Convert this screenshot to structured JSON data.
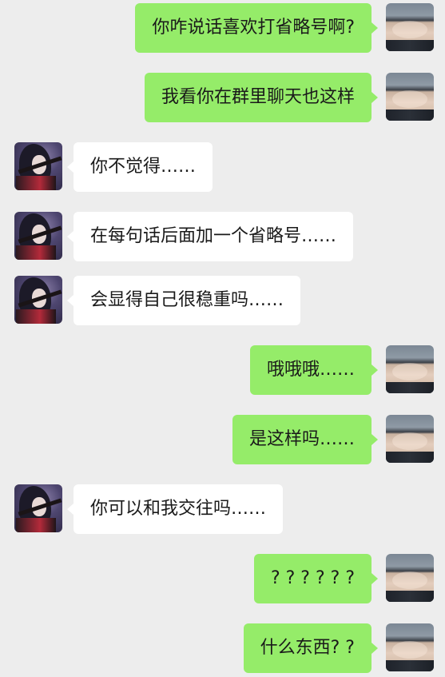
{
  "messages": [
    {
      "side": "right",
      "text": "你咋说话喜欢打省略号啊?"
    },
    {
      "side": "right",
      "text": "我看你在群里聊天也这样"
    },
    {
      "side": "left",
      "text": "你不觉得……"
    },
    {
      "side": "left",
      "text": "在每句话后面加一个省略号……"
    },
    {
      "side": "left",
      "text": "会显得自己很稳重吗……"
    },
    {
      "side": "right",
      "text": "哦哦哦……"
    },
    {
      "side": "right",
      "text": "是这样吗……"
    },
    {
      "side": "left",
      "text": "你可以和我交往吗……"
    },
    {
      "side": "right",
      "text": "? ? ? ? ? ?"
    },
    {
      "side": "right",
      "text": "什么东西? ?"
    }
  ],
  "colors": {
    "background": "#ededed",
    "sent_bubble": "#95ec69",
    "received_bubble": "#ffffff",
    "text": "#1a1a1a"
  },
  "icons": {
    "self_avatar": "avatar-self-photo",
    "other_avatar": "avatar-anime-character"
  }
}
